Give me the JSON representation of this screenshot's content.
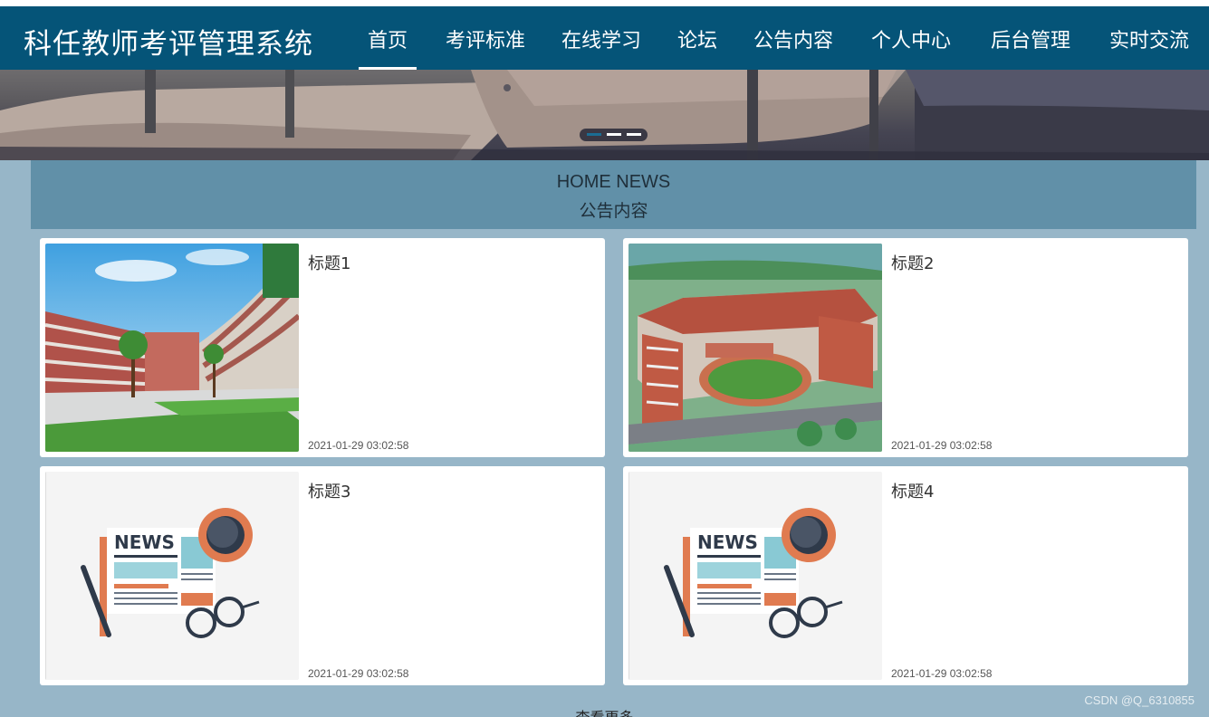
{
  "app": {
    "title": "科任教师考评管理系统"
  },
  "nav": {
    "items": [
      {
        "label": "首页",
        "active": true
      },
      {
        "label": "考评标准"
      },
      {
        "label": "在线学习"
      },
      {
        "label": "论坛"
      },
      {
        "label": "公告内容"
      },
      {
        "label": "个人中心"
      },
      {
        "label": "后台管理"
      },
      {
        "label": "实时交流"
      }
    ]
  },
  "carousel": {
    "slides": 3,
    "active_index": 0
  },
  "section": {
    "title_en": "HOME NEWS",
    "title_cn": "公告内容"
  },
  "news": [
    {
      "title": "标题1",
      "date": "2021-01-29 03:02:58",
      "image": "campus-photo"
    },
    {
      "title": "标题2",
      "date": "2021-01-29 03:02:58",
      "image": "aerial-campus-photo"
    },
    {
      "title": "标题3",
      "date": "2021-01-29 03:02:58",
      "image": "newspaper-illustration"
    },
    {
      "title": "标题4",
      "date": "2021-01-29 03:02:58",
      "image": "newspaper-illustration"
    }
  ],
  "more_label": "查看更多",
  "watermark": "CSDN @Q_6310855",
  "colors": {
    "nav_bg": "#055478",
    "page_bg": "#97b6c8",
    "section_bg": "#6190a8",
    "card_bg": "#ffffff"
  }
}
